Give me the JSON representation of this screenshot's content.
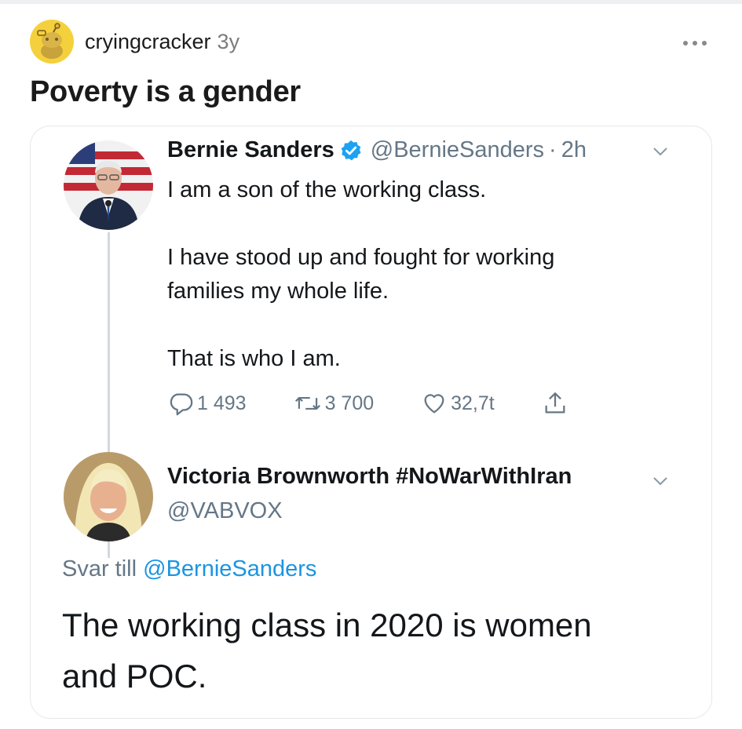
{
  "post": {
    "author": "cryingcracker",
    "age": "3y",
    "title": "Poverty is a gender",
    "more_icon": "more-horizontal-icon"
  },
  "tweet": {
    "name": "Bernie Sanders",
    "handle": "@BernieSanders",
    "separator": "·",
    "time": "2h",
    "lines": [
      "I am a son of the working class.",
      "I have stood up and fought for working",
      "families my whole life.",
      "That is who I am."
    ],
    "replies": "1 493",
    "retweets": "3 700",
    "likes": "32,7t"
  },
  "reply": {
    "name": "Victoria Brownworth #NoWarWithIran",
    "handle": "@VABVOX",
    "reply_to_prefix": "Svar till",
    "reply_to_handle": "@BernieSanders",
    "text_line1": "The working class in 2020 is women",
    "text_line2": "and POC."
  },
  "colors": {
    "snoo_bg": "#f4d13c",
    "twitter_blue": "#1b95e0",
    "muted": "#657786"
  }
}
